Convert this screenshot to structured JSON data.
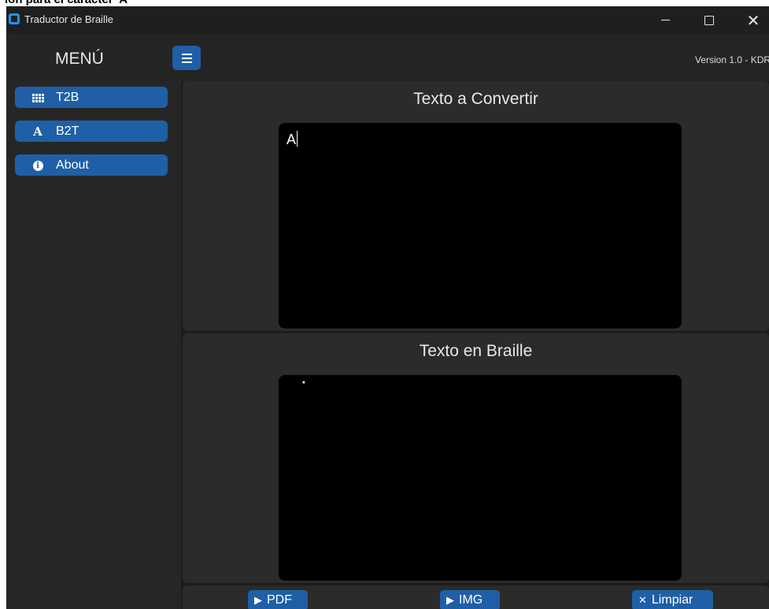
{
  "top_strip": {
    "text": "ión para el carácter 'A'"
  },
  "window": {
    "title": "Traductor de Braille",
    "controls": {
      "close_glyph": "✕"
    }
  },
  "header": {
    "menu_title": "MENÚ",
    "version": "Version 1.0 - KDR"
  },
  "sidebar": {
    "items": [
      {
        "icon": "braille-grid-icon",
        "label": "T2B"
      },
      {
        "icon": "letter-a-icon",
        "label": "B2T",
        "icon_text": "A"
      },
      {
        "icon": "info-icon",
        "label": "About",
        "icon_text": "i"
      }
    ]
  },
  "input_panel": {
    "title": "Texto a Convertir",
    "value": "A"
  },
  "output_panel": {
    "title": "Texto en Braille",
    "value": "⠁"
  },
  "actions": {
    "pdf": {
      "label": "PDF",
      "icon_glyph": "▶"
    },
    "img": {
      "label": "IMG",
      "icon_glyph": "▶"
    },
    "clear": {
      "label": "Limpiar",
      "icon_glyph": "✕"
    }
  },
  "colors": {
    "accent": "#1f5fa6",
    "window_bg": "#1c1c1c",
    "panel_bg": "#2b2b2b",
    "textbox_bg": "#000000"
  }
}
